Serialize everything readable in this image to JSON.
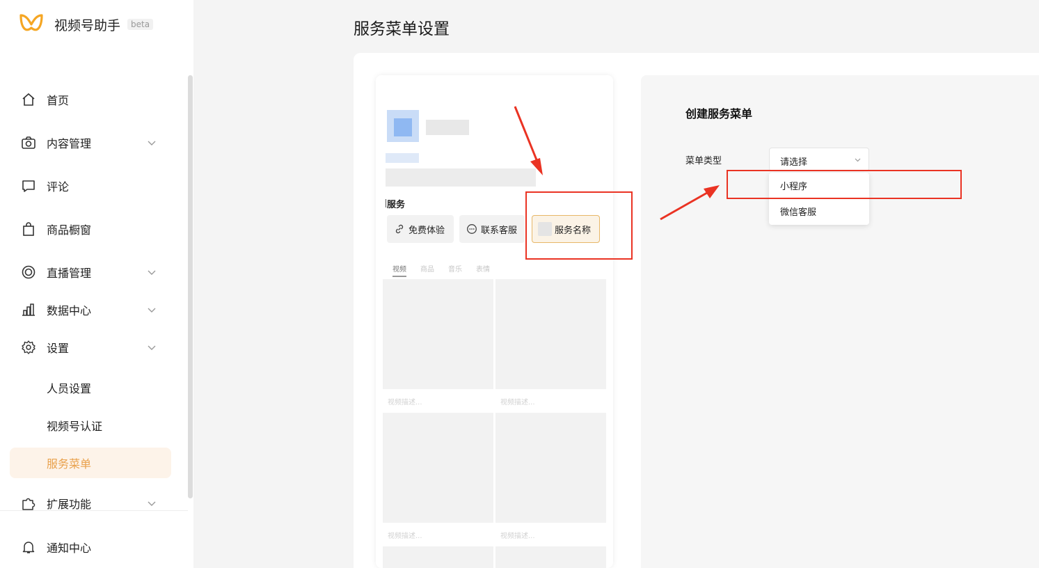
{
  "app": {
    "name": "视频号助手",
    "badge": "beta"
  },
  "nav": {
    "home": "首页",
    "content": "内容管理",
    "comments": "评论",
    "shop": "商品橱窗",
    "live": "直播管理",
    "data": "数据中心",
    "settings": "设置",
    "staff": "人员设置",
    "verify": "视频号认证",
    "service_menu": "服务菜单",
    "extensions": "扩展功能",
    "notifications": "通知中心"
  },
  "page": {
    "title": "服务菜单设置"
  },
  "preview": {
    "service_title": "服务",
    "buttons": [
      "免费体验",
      "联系客服",
      "服务名称"
    ],
    "tabs": [
      "视频",
      "商品",
      "音乐",
      "表情"
    ],
    "video_caption": "视频描述..."
  },
  "form": {
    "title": "创建服务菜单",
    "menu_type_label": "菜单类型",
    "select_placeholder": "请选择",
    "options": [
      "小程序",
      "微信客服"
    ]
  },
  "colors": {
    "accent": "#e9a14c",
    "annotation": "#ea3323"
  }
}
